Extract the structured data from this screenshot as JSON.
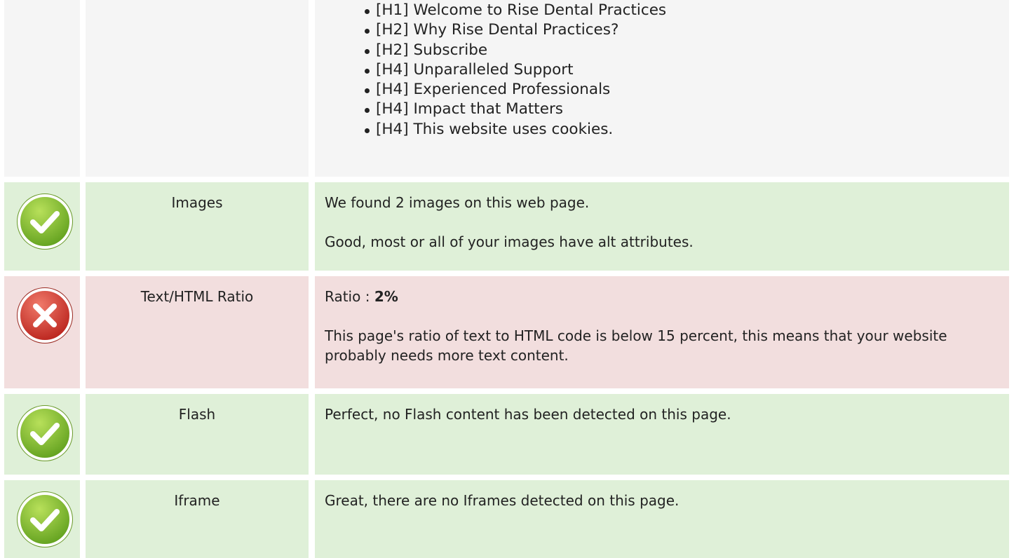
{
  "headings": {
    "items": [
      "[H1] Welcome to Rise Dental Practices",
      "[H2] Why Rise Dental Practices?",
      "[H2] Subscribe",
      "[H4] Unparalleled Support",
      "[H4] Experienced Professionals",
      "[H4] Impact that Matters",
      "[H4] This website uses cookies."
    ]
  },
  "images": {
    "status": "pass",
    "icon": "check-circle-icon",
    "label": "Images",
    "line1": "We found 2 images on this web page.",
    "line2": "Good, most or all of your images have alt attributes."
  },
  "ratio": {
    "status": "fail",
    "icon": "x-circle-icon",
    "label": "Text/HTML Ratio",
    "prefix": "Ratio : ",
    "value": "2%",
    "line2": "This page's ratio of text to HTML code is below 15 percent, this means that your website probably needs more text content."
  },
  "flash": {
    "status": "pass",
    "icon": "check-circle-icon",
    "label": "Flash",
    "line1": "Perfect, no Flash content has been detected on this page."
  },
  "iframe": {
    "status": "pass",
    "icon": "check-circle-icon",
    "label": "Iframe",
    "line1": "Great, there are no Iframes detected on this page."
  },
  "colors": {
    "pass_bg": "#dff0d8",
    "fail_bg": "#f2dede",
    "pass_icon": "#7cbf2a",
    "fail_icon": "#d9302a"
  }
}
